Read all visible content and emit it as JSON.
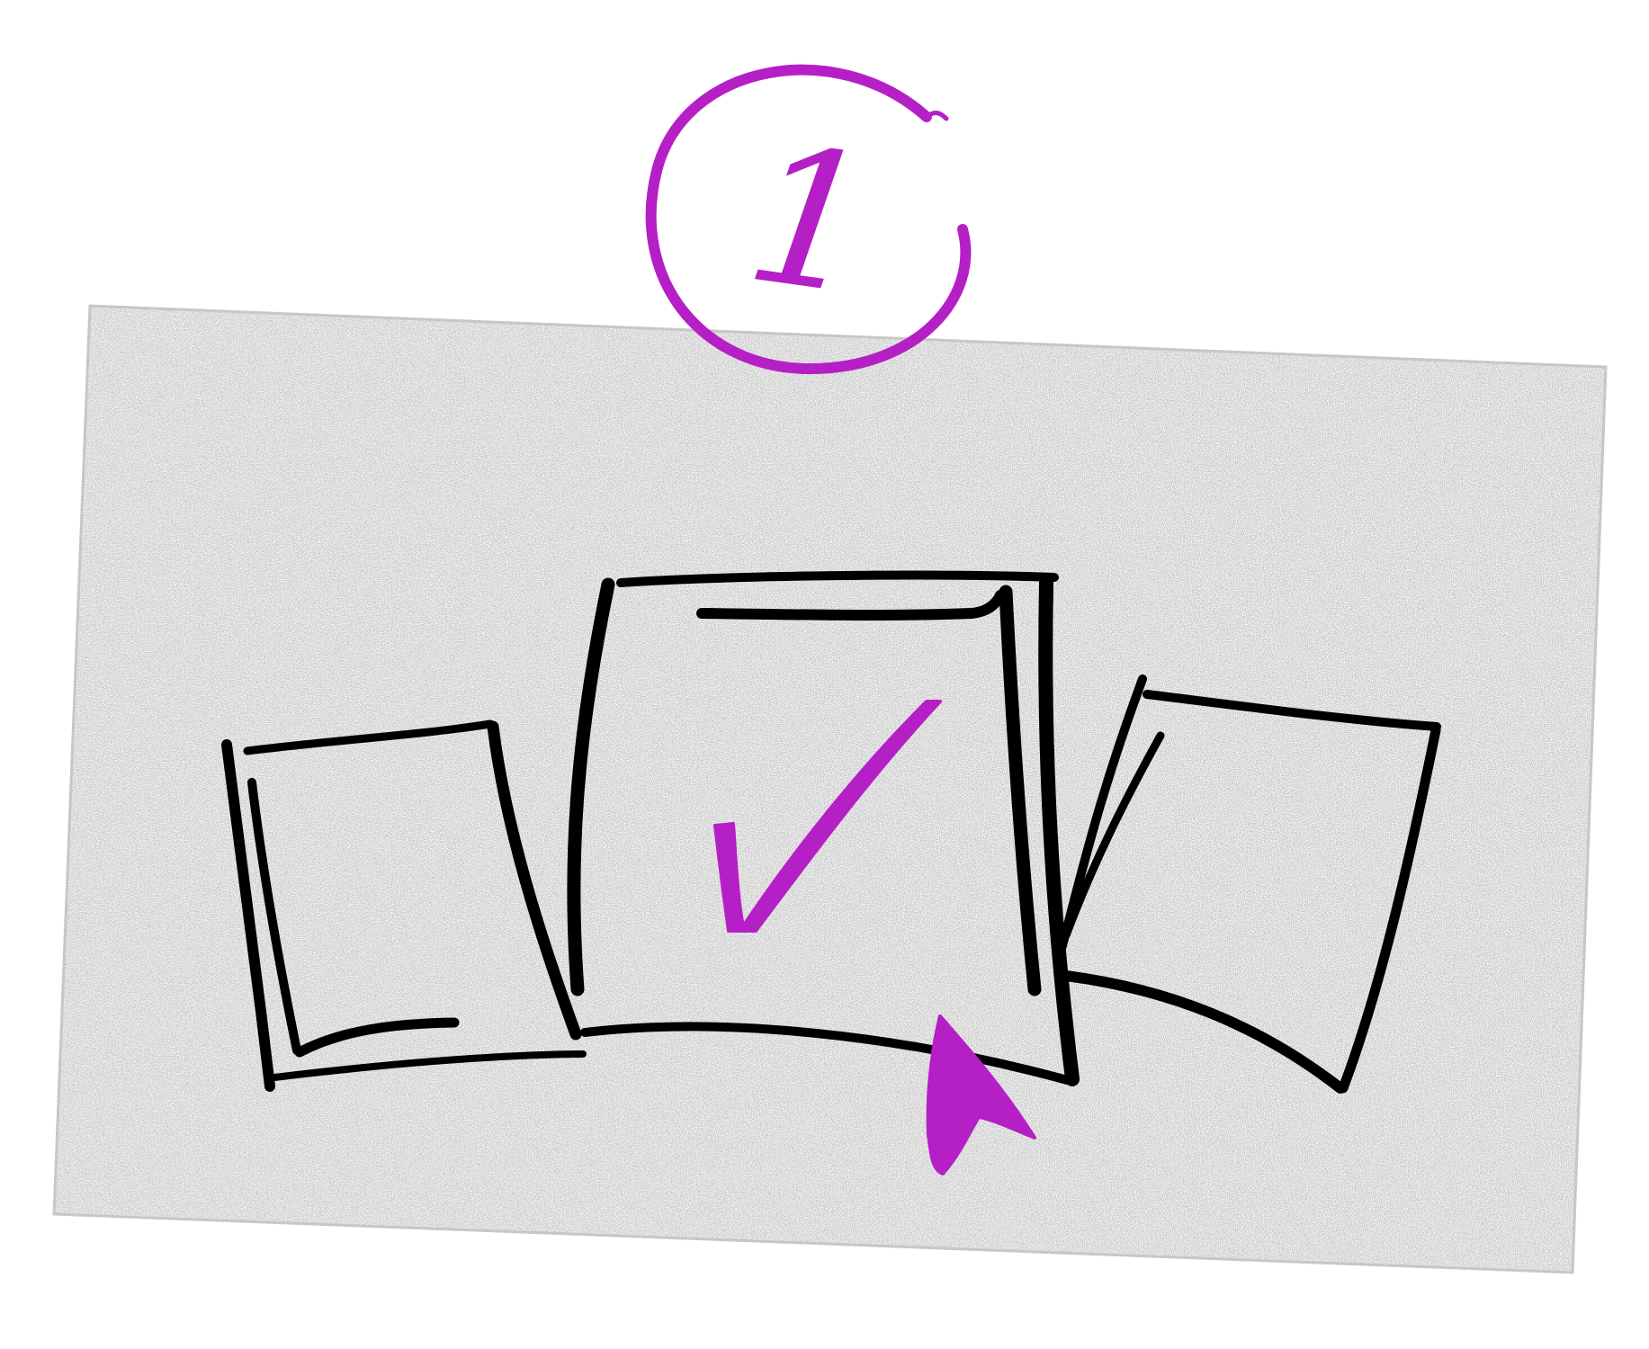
{
  "illustration": {
    "step_number": "1",
    "options": [
      {
        "name": "left-option",
        "selected": false
      },
      {
        "name": "center-option",
        "selected": true
      },
      {
        "name": "right-option",
        "selected": false
      }
    ],
    "pointer": "mouse-cursor-icon",
    "colors": {
      "accent": "#b51fc6",
      "ink": "#000000",
      "paper": "#f4f4f4",
      "paper_border": "#c8c8c8"
    }
  }
}
